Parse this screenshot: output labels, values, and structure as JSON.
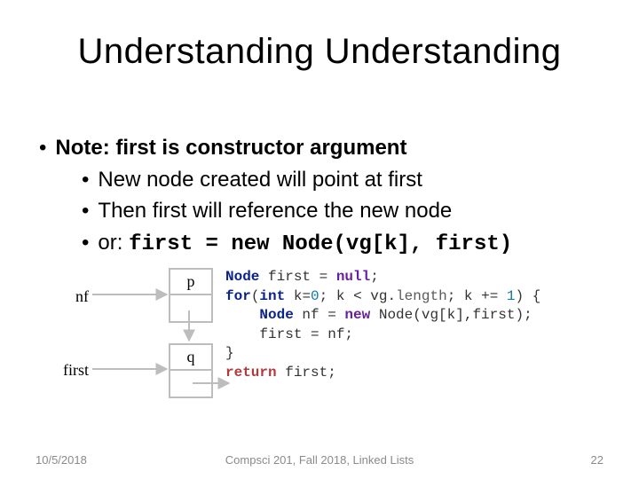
{
  "title": "Understanding Understanding",
  "bullets": {
    "b1": "Note: first is constructor argument",
    "b2a": "New node created will point at first",
    "b2b": "Then first will reference the new node",
    "b2c_prefix": "or: ",
    "b2c_code": "first = new Node(vg[k], first)"
  },
  "diagram": {
    "var_nf": "nf",
    "var_first": "first",
    "node_p": "p",
    "node_q": "q"
  },
  "code": {
    "l1_a": "Node",
    "l1_b": " first = ",
    "l1_c": "null",
    "l1_d": ";",
    "l2_a": "for",
    "l2_b": "(",
    "l2_c": "int",
    "l2_d": " k=",
    "l2_e": "0",
    "l2_f": "; k < vg.",
    "l2_g": "length",
    "l2_h": "; k += ",
    "l2_i": "1",
    "l2_j": ") {",
    "l3_a": "    ",
    "l3_b": "Node",
    "l3_c": " nf = ",
    "l3_d": "new",
    "l3_e": " Node(vg[k],first);",
    "l4": "    first = nf;",
    "l5": "}",
    "l6_a": "return",
    "l6_b": " first;"
  },
  "footer": {
    "date": "10/5/2018",
    "mid": "Compsci 201, Fall 2018, Linked Lists",
    "page": "22"
  }
}
